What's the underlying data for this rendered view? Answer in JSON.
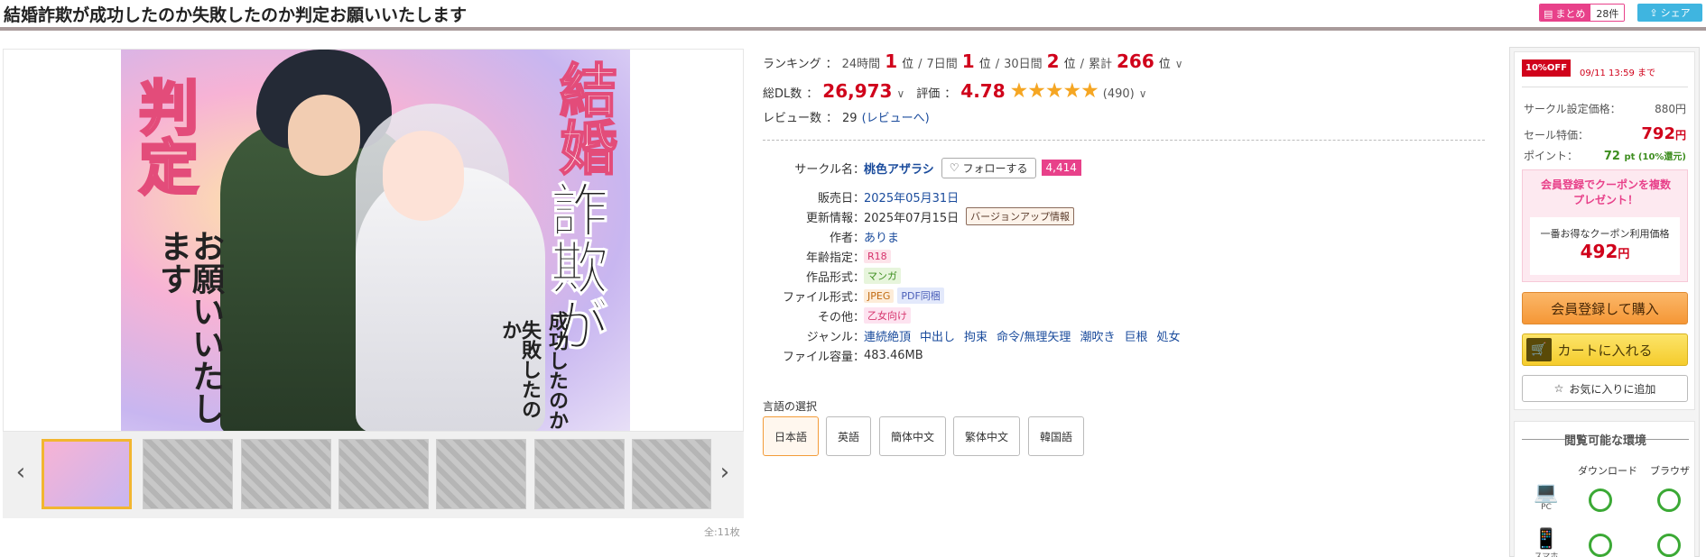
{
  "header": {
    "title": "結婚詐欺が成功したのか失敗したのか判定お願いいたします",
    "matome_label": "まとめ",
    "matome_count": "28件",
    "share_label": "シェア"
  },
  "gallery": {
    "cover_text": {
      "kekkon": "結婚",
      "sagi": "詐欺が",
      "seikou": "成功したのか",
      "shippai": "失敗したのか",
      "hantei": "判定",
      "onegai": "お願いいたします"
    },
    "count_label": "全:11枚"
  },
  "ranking": {
    "label": "ランキング",
    "periods": [
      {
        "label": "24時間",
        "value": "1",
        "unit": "位"
      },
      {
        "label": "7日間",
        "value": "1",
        "unit": "位"
      },
      {
        "label": "30日間",
        "value": "2",
        "unit": "位"
      },
      {
        "label": "累計",
        "value": "266",
        "unit": "位"
      }
    ]
  },
  "stats": {
    "downloads_label": "総DL数",
    "downloads": "26,973",
    "rating_label": "評価",
    "rating": "4.78",
    "rating_count": "(490)",
    "review_label": "レビュー数",
    "review_count": "29",
    "review_link": "(レビューへ)"
  },
  "spec": {
    "circle_label": "サークル名",
    "circle": "桃色アザラシ",
    "follow": "フォローする",
    "follow_count": "4,414",
    "release_label": "販売日",
    "release": "2025年05月31日",
    "update_label": "更新情報",
    "update": "2025年07月15日",
    "update_tag": "バージョンアップ情報",
    "author_label": "作者",
    "author": "ありま",
    "age_label": "年齢指定",
    "age": "R18",
    "format_label": "作品形式",
    "format": "マンガ",
    "file_label": "ファイル形式",
    "file1": "JPEG",
    "file2": "PDF同梱",
    "other_label": "その他",
    "other": "乙女向け",
    "genre_label": "ジャンル",
    "genres": [
      "連続絶頂",
      "中出し",
      "拘束",
      "命令/無理矢理",
      "潮吹き",
      "巨根",
      "処女"
    ],
    "size_label": "ファイル容量",
    "size": "483.46MB"
  },
  "languages": {
    "title": "言語の選択",
    "items": [
      "日本語",
      "英語",
      "簡体中文",
      "繁体中文",
      "韓国語"
    ],
    "selected": "日本語"
  },
  "purchase": {
    "off_badge": "10%OFF",
    "off_until": "09/11 13:59 まで",
    "list_label": "サークル設定価格：",
    "list_price": "880円",
    "sale_label": "セール特価：",
    "sale_price": "792",
    "sale_unit": "円",
    "point_label": "ポイント：",
    "point_value": "72",
    "point_note": "pt (10%還元)",
    "coupon_head_1": "会員登録でクーポンを複数",
    "coupon_head_2": "プレゼント！",
    "coupon_label": "一番お得なクーポン利用価格",
    "coupon_price": "492",
    "coupon_unit": "円",
    "register_button": "会員登録して購入",
    "cart_button": "カートに入れる",
    "fav_button": "お気に入りに追加"
  },
  "environment": {
    "title": "閲覧可能な環境",
    "col_download": "ダウンロード",
    "col_browser": "ブラウザ",
    "device_pc": "PC",
    "device_phone": "スマホ"
  },
  "colors": {
    "accent_red": "#d0021b",
    "star": "#f5a623",
    "link": "#1a4b9c",
    "ok_green": "#3ba935"
  }
}
